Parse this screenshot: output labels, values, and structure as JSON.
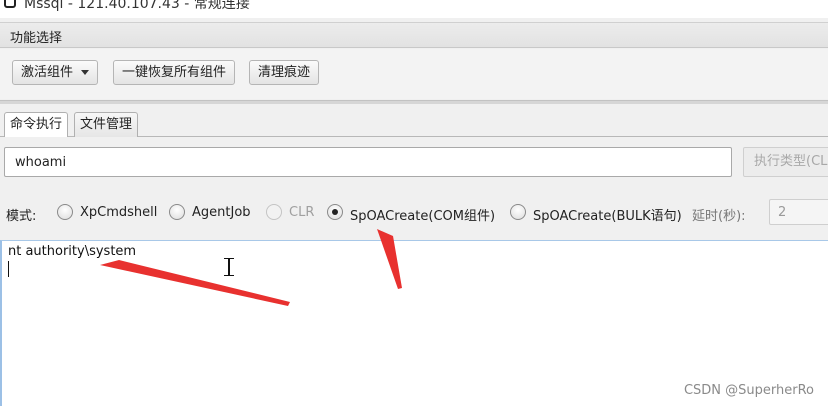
{
  "window": {
    "title": "Mssql - 121.40.107.43 - 常规连接"
  },
  "section": {
    "header": "功能选择"
  },
  "toolbar": {
    "activate_label": "激活组件",
    "restore_label": "一键恢复所有组件",
    "clean_label": "清理痕迹"
  },
  "tabs": [
    {
      "label": "命令执行",
      "active": true
    },
    {
      "label": "文件管理",
      "active": false
    }
  ],
  "command": {
    "value": "whoami",
    "exec_label": "执行类型(CLR)"
  },
  "mode": {
    "label": "模式:",
    "options": [
      {
        "label": "XpCmdshell",
        "checked": false,
        "disabled": false
      },
      {
        "label": "AgentJob",
        "checked": false,
        "disabled": false
      },
      {
        "label": "CLR",
        "checked": false,
        "disabled": true
      },
      {
        "label": "SpOACreate(COM组件)",
        "checked": true,
        "disabled": false
      },
      {
        "label": "SpOACreate(BULK语句)",
        "checked": false,
        "disabled": false
      }
    ],
    "delay_label": "延时(秒):",
    "delay_value": "2"
  },
  "output": {
    "text": "nt authority\\system"
  },
  "watermark": "CSDN @SuperherRo",
  "colors": {
    "annotation_arrow": "#e8312f",
    "output_border": "#9cc0e6"
  }
}
